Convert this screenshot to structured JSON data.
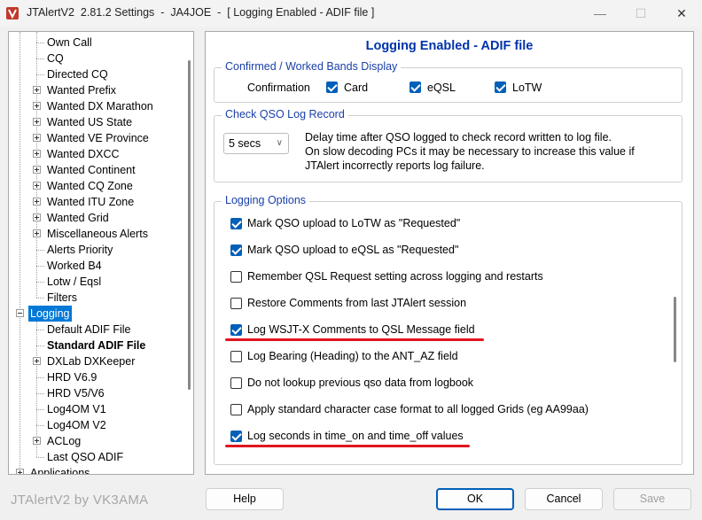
{
  "window": {
    "title": "JTAlertV2  2.81.2 Settings  -  JA4JOE  -  [ Logging Enabled - ADIF file ]"
  },
  "tree": {
    "items": [
      {
        "label": "Own Call",
        "expander": "none"
      },
      {
        "label": "CQ",
        "expander": "none"
      },
      {
        "label": "Directed CQ",
        "expander": "none"
      },
      {
        "label": "Wanted Prefix",
        "expander": "plus"
      },
      {
        "label": "Wanted DX Marathon",
        "expander": "plus"
      },
      {
        "label": "Wanted US State",
        "expander": "plus"
      },
      {
        "label": "Wanted VE Province",
        "expander": "plus"
      },
      {
        "label": "Wanted DXCC",
        "expander": "plus"
      },
      {
        "label": "Wanted Continent",
        "expander": "plus"
      },
      {
        "label": "Wanted CQ Zone",
        "expander": "plus"
      },
      {
        "label": "Wanted ITU Zone",
        "expander": "plus"
      },
      {
        "label": "Wanted Grid",
        "expander": "plus"
      },
      {
        "label": "Miscellaneous Alerts",
        "expander": "plus"
      },
      {
        "label": "Alerts Priority",
        "expander": "none"
      },
      {
        "label": "Worked B4",
        "expander": "none"
      },
      {
        "label": "Lotw / Eqsl",
        "expander": "none"
      },
      {
        "label": "Filters",
        "expander": "none"
      },
      {
        "label": "Logging",
        "expander": "minus",
        "selected": true
      },
      {
        "label": "Default ADIF File",
        "expander": "none"
      },
      {
        "label": "Standard ADIF File",
        "expander": "none",
        "bold": true
      },
      {
        "label": "DXLab DXKeeper",
        "expander": "plus"
      },
      {
        "label": "HRD V6.9",
        "expander": "none"
      },
      {
        "label": "HRD V5/V6",
        "expander": "none"
      },
      {
        "label": "Log4OM V1",
        "expander": "none"
      },
      {
        "label": "Log4OM V2",
        "expander": "none"
      },
      {
        "label": "ACLog",
        "expander": "plus"
      },
      {
        "label": "Last QSO ADIF",
        "expander": "none"
      },
      {
        "label": "Applications",
        "expander": "plus"
      }
    ]
  },
  "panel": {
    "title": "Logging Enabled - ADIF file",
    "confirmed": {
      "title": "Confirmed / Worked Bands Display",
      "label": "Confirmation",
      "options": [
        {
          "label": "Card",
          "checked": true
        },
        {
          "label": "eQSL",
          "checked": true
        },
        {
          "label": "LoTW",
          "checked": true
        }
      ]
    },
    "check": {
      "title": "Check QSO Log Record",
      "delay_value": "5 secs",
      "description": [
        "Delay time after QSO logged to check record written to log file.",
        "On slow decoding PCs it may be necessary to increase this value if",
        "JTAlert incorrectly reports log failure."
      ]
    },
    "options": {
      "title": "Logging Options",
      "items": [
        {
          "label": "Mark QSO upload to LoTW as \"Requested\"",
          "checked": true,
          "highlight": false
        },
        {
          "label": "Mark QSO upload to eQSL as \"Requested\"",
          "checked": true,
          "highlight": false
        },
        {
          "label": "Remember QSL Request setting across logging and restarts",
          "checked": false,
          "highlight": false
        },
        {
          "label": "Restore Comments from last JTAlert session",
          "checked": false,
          "highlight": false
        },
        {
          "label": "Log WSJT-X Comments to QSL Message field",
          "checked": true,
          "highlight": true
        },
        {
          "label": "Log Bearing (Heading) to the ANT_AZ field",
          "checked": false,
          "highlight": false
        },
        {
          "label": "Do not lookup previous qso data from logbook",
          "checked": false,
          "highlight": false
        },
        {
          "label": "Apply standard character case format to all logged Grids (eg AA99aa)",
          "checked": false,
          "highlight": false
        },
        {
          "label": "Log seconds in time_on and time_off values",
          "checked": true,
          "highlight": true
        }
      ]
    }
  },
  "footer": {
    "brand": "JTAlertV2 by VK3AMA",
    "help": "Help",
    "ok": "OK",
    "cancel": "Cancel",
    "save": "Save"
  },
  "colors": {
    "accent": "#005fb8",
    "title_blue": "#0033aa",
    "highlight_red": "#e0151f"
  }
}
